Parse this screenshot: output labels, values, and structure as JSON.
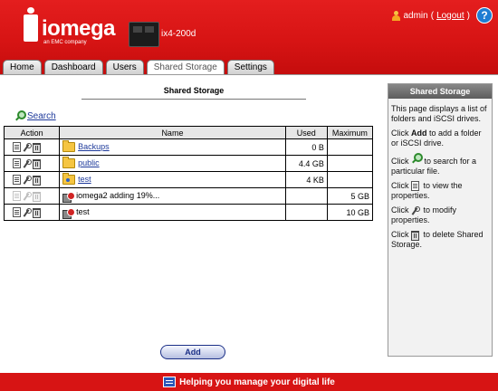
{
  "header": {
    "brand": "iomega",
    "brand_sub": "an EMC company",
    "device_name": "ix4-200d",
    "user": "admin",
    "logout_label": "Logout",
    "help_label": "?"
  },
  "tabs": [
    {
      "label": "Home"
    },
    {
      "label": "Dashboard"
    },
    {
      "label": "Users"
    },
    {
      "label": "Shared Storage",
      "active": true
    },
    {
      "label": "Settings"
    }
  ],
  "main": {
    "title": "Shared Storage",
    "search_label": "Search",
    "columns": [
      "Action",
      "Name",
      "Used",
      "Maximum"
    ],
    "rows": [
      {
        "name": "Backups",
        "used": "0 B",
        "max": "",
        "type": "folder",
        "link": true
      },
      {
        "name": "public",
        "used": "4.4 GB",
        "max": "",
        "type": "folder",
        "link": true
      },
      {
        "name": "test",
        "used": "4 KB",
        "max": "",
        "type": "folder-person",
        "link": true
      },
      {
        "name": "iomega2 adding 19%...",
        "used": "",
        "max": "5 GB",
        "type": "iscsi",
        "link": false
      },
      {
        "name": "test",
        "used": "",
        "max": "10 GB",
        "type": "iscsi",
        "link": false
      }
    ],
    "add_label": "Add"
  },
  "panel": {
    "title": "Shared Storage",
    "p1": "This page displays a list of folders and iSCSI drives.",
    "p2_pre": "Click ",
    "p2_bold": "Add",
    "p2_post": " to add a folder or iSCSI drive.",
    "p3_pre": "Click ",
    "p3_post": " to search for a particular file.",
    "p4_pre": "Click ",
    "p4_post": " to view the properties.",
    "p5_pre": "Click ",
    "p5_post": " to modify properties.",
    "p6_pre": "Click ",
    "p6_post": " to delete Shared Storage."
  },
  "footer": {
    "tagline": "Helping you manage your digital life"
  },
  "colors": {
    "header_red": "#d71414",
    "link_blue": "#1e3a9b",
    "panel_header": "#6f6f6f"
  }
}
